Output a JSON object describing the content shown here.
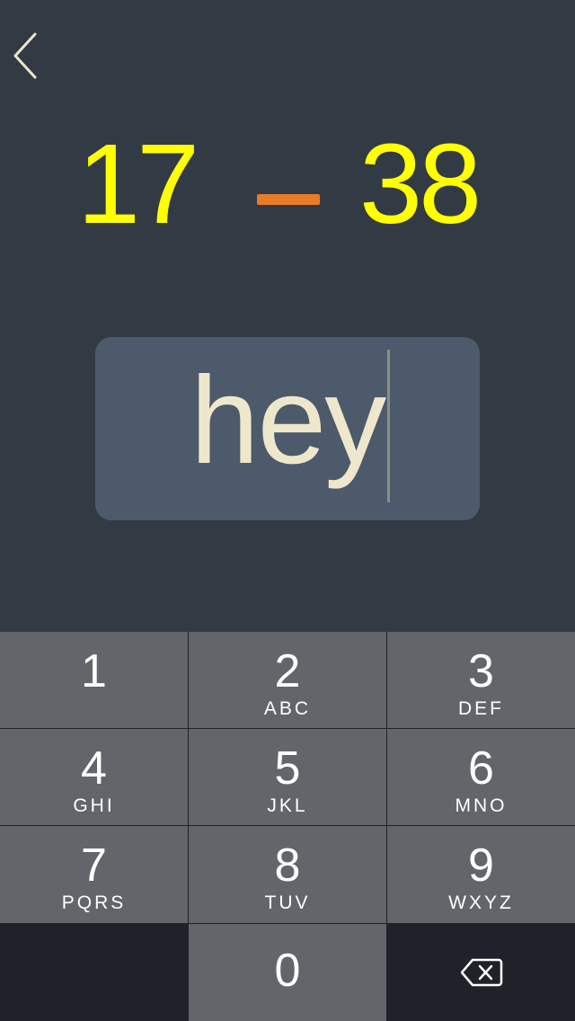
{
  "colors": {
    "background": "#323a44",
    "operand": "#ffff00",
    "operator": "#e87c29",
    "answer_box": "#4c5a6b",
    "answer_text": "#eee7cb",
    "back_chevron": "#eee7cb",
    "key_background": "#62656a",
    "keypad_gap": "#1f2228",
    "key_text": "#ffffff"
  },
  "navigation": {
    "back_icon": "chevron-left-icon"
  },
  "problem": {
    "operand_a": "17",
    "operator": "minus",
    "operand_b": "38"
  },
  "answer": {
    "value": "hey"
  },
  "keypad": {
    "keys": [
      {
        "digit": "1",
        "letters": ""
      },
      {
        "digit": "2",
        "letters": "ABC"
      },
      {
        "digit": "3",
        "letters": "DEF"
      },
      {
        "digit": "4",
        "letters": "GHI"
      },
      {
        "digit": "5",
        "letters": "JKL"
      },
      {
        "digit": "6",
        "letters": "MNO"
      },
      {
        "digit": "7",
        "letters": "PQRS"
      },
      {
        "digit": "8",
        "letters": "TUV"
      },
      {
        "digit": "9",
        "letters": "WXYZ"
      },
      {
        "digit": "0",
        "letters": ""
      }
    ],
    "delete_icon": "backspace-icon"
  }
}
